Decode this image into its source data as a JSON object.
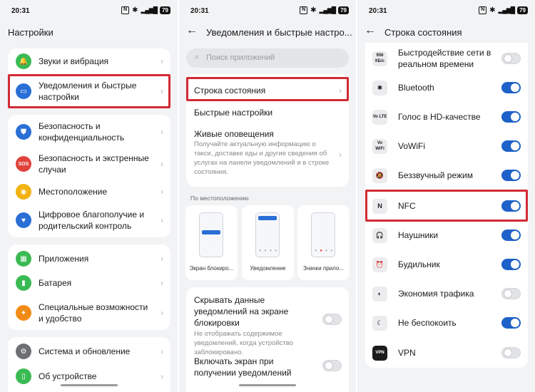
{
  "status": {
    "time": "20:31",
    "nfc": "N",
    "bluetooth": "✱",
    "signal": "▂▄▆█",
    "battery": "79"
  },
  "screen1": {
    "title": "Настройки",
    "items": [
      {
        "label": "Звуки и вибрация",
        "icon": "bell-icon",
        "glyph": "🔔",
        "color": "#3aba53"
      },
      {
        "label": "Уведомления и быстрые настройки",
        "icon": "notifications-icon",
        "glyph": "▭",
        "color": "#2a6fd6"
      },
      {
        "label": "Безопасность и конфиденциальность",
        "icon": "shield-icon",
        "glyph": "⛊",
        "color": "#2a6fd6"
      },
      {
        "label": "Безопасность и экстренные случаи",
        "icon": "sos-icon",
        "glyph": "SOS",
        "color": "#e0423a"
      },
      {
        "label": "Местоположение",
        "icon": "location-icon",
        "glyph": "◉",
        "color": "#f2b211"
      },
      {
        "label": "Цифровое благополучие и родительский контроль",
        "icon": "wellbeing-icon",
        "glyph": "♥",
        "color": "#2a6fd6"
      },
      {
        "label": "Приложения",
        "icon": "apps-icon",
        "glyph": "▦",
        "color": "#3aba53"
      },
      {
        "label": "Батарея",
        "icon": "battery-icon",
        "glyph": "▮",
        "color": "#3aba53"
      },
      {
        "label": "Специальные возможности и удобство",
        "icon": "accessibility-icon",
        "glyph": "✦",
        "color": "#f28b15"
      },
      {
        "label": "Система и обновление",
        "icon": "gear-icon",
        "glyph": "⚙",
        "color": "#6d6f73"
      },
      {
        "label": "Об устройстве",
        "icon": "device-icon",
        "glyph": "▯",
        "color": "#3aba53"
      }
    ]
  },
  "screen2": {
    "title": "Уведомления и быстрые настро...",
    "search_placeholder": "Поиск приложений",
    "status_bar_item": "Строка состояния",
    "quick_settings": "Быстрые настройки",
    "live_title": "Живые оповещения",
    "live_desc": "Получайте актуальную информацию о такси, доставке еды и другие сведения об услугах на панели уведомлений и в строке состояния.",
    "by_location": "По местоположению",
    "styles": [
      "Экран блокиро...",
      "Уведомление",
      "Значки прило..."
    ],
    "hide_title": "Скрывать данные уведомлений на экране блокировки",
    "hide_desc": "Не отображать содержимое уведомлений, когда устройство заблокировано.",
    "hide_on": false,
    "wake_title": "Включать экран при получении уведомлений",
    "wake_on": false
  },
  "screen3": {
    "title": "Строка состояния",
    "items": [
      {
        "label": "Быстродействие сети в реальном времени",
        "glyph": "956 КБ/с",
        "icon": "network-speed-icon",
        "on": false
      },
      {
        "label": "Bluetooth",
        "glyph": "✱",
        "icon": "bluetooth-icon",
        "on": true
      },
      {
        "label": "Голос в HD-качестве",
        "glyph": "Vo LTE",
        "icon": "volte-icon",
        "on": true
      },
      {
        "label": "VoWiFi",
        "glyph": "Vo WiFi",
        "icon": "vowifi-icon",
        "on": true
      },
      {
        "label": "Беззвучный режим",
        "glyph": "🔕",
        "icon": "silent-icon",
        "on": true
      },
      {
        "label": "NFC",
        "glyph": "N",
        "icon": "nfc-icon",
        "on": true
      },
      {
        "label": "Наушники",
        "glyph": "🎧",
        "icon": "headphones-icon",
        "on": true
      },
      {
        "label": "Будильник",
        "glyph": "⏰",
        "icon": "alarm-icon",
        "on": true
      },
      {
        "label": "Экономия трафика",
        "glyph": "◐",
        "icon": "data-saver-icon",
        "on": false
      },
      {
        "label": "Не беспокоить",
        "glyph": "☾",
        "icon": "dnd-icon",
        "on": true
      },
      {
        "label": "VPN",
        "glyph": "VPN",
        "icon": "vpn-icon",
        "on": false
      }
    ]
  }
}
